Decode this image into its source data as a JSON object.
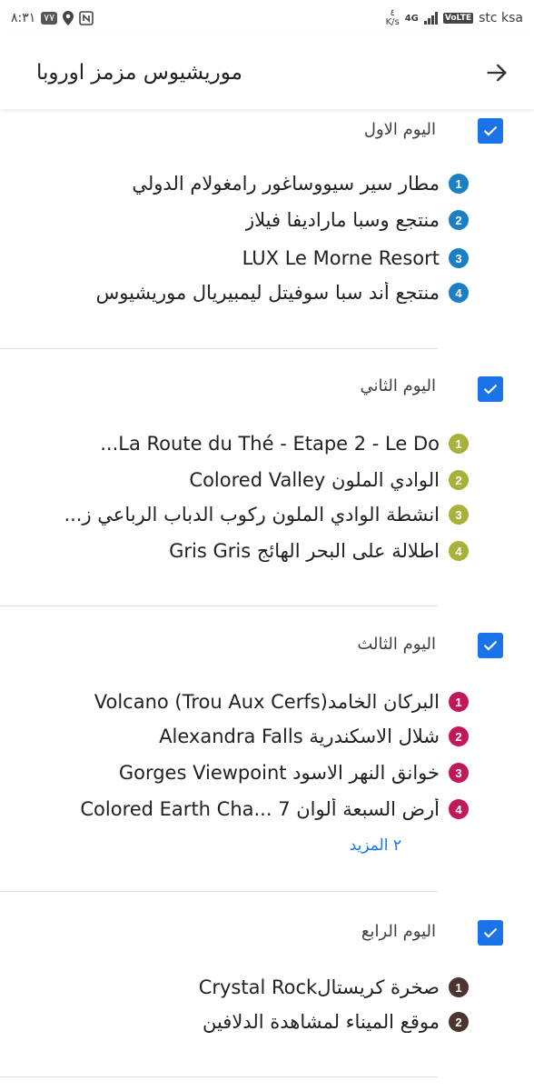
{
  "status_bar": {
    "time": "٨:٣١",
    "badge": "٧٧",
    "speed_value": "٤",
    "speed_unit": "K/s",
    "network": "4G",
    "volte": "VoLTE",
    "carrier": "stc ksa"
  },
  "header": {
    "title": "موريشيوس مزمز اوروبا"
  },
  "days": [
    {
      "title": "اليوم الاول",
      "color": "#1a7fc4",
      "stops": [
        {
          "num": "1",
          "name": "مطار سير سيووساغور رامغولام الدولي"
        },
        {
          "num": "2",
          "name": "منتجع وسبا مارادیفا فيلاز"
        },
        {
          "num": "3",
          "name": "LUX Le Morne Resort"
        },
        {
          "num": "4",
          "name": "منتجع أند سبا سوفيتل ليمبيريال موريشيوس"
        }
      ]
    },
    {
      "title": "اليوم الثاني",
      "color": "#a8b13a",
      "stops": [
        {
          "num": "1",
          "name": "La Route du Thé - Etape 2 - Le Do..."
        },
        {
          "num": "2",
          "name": "الوادي الملون Colored Valley"
        },
        {
          "num": "3",
          "name": "انشطة الوادي الملون ركوب الدباب الرباعي ز..."
        },
        {
          "num": "4",
          "name": "اطلالة على البحر الهائج Gris Gris"
        }
      ]
    },
    {
      "title": "اليوم الثالث",
      "color": "#c2185b",
      "stops": [
        {
          "num": "1",
          "name": "البركان الخامدVolcano (Trou Aux Cerfs)"
        },
        {
          "num": "2",
          "name": "شلال الاسكندرية Alexandra Falls"
        },
        {
          "num": "3",
          "name": "خوانق النهر الاسود Gorges Viewpoint"
        },
        {
          "num": "4",
          "name": "أرض السبعة ألوان 7 ...Colored Earth Cha"
        }
      ],
      "more": "٢ المزيد"
    },
    {
      "title": "اليوم الرابع",
      "color": "#4e342e",
      "stops": [
        {
          "num": "1",
          "name": "صخرة كريستالCrystal Rock"
        },
        {
          "num": "2",
          "name": "موقع الميناء لمشاهدة الدلافين"
        }
      ]
    }
  ]
}
